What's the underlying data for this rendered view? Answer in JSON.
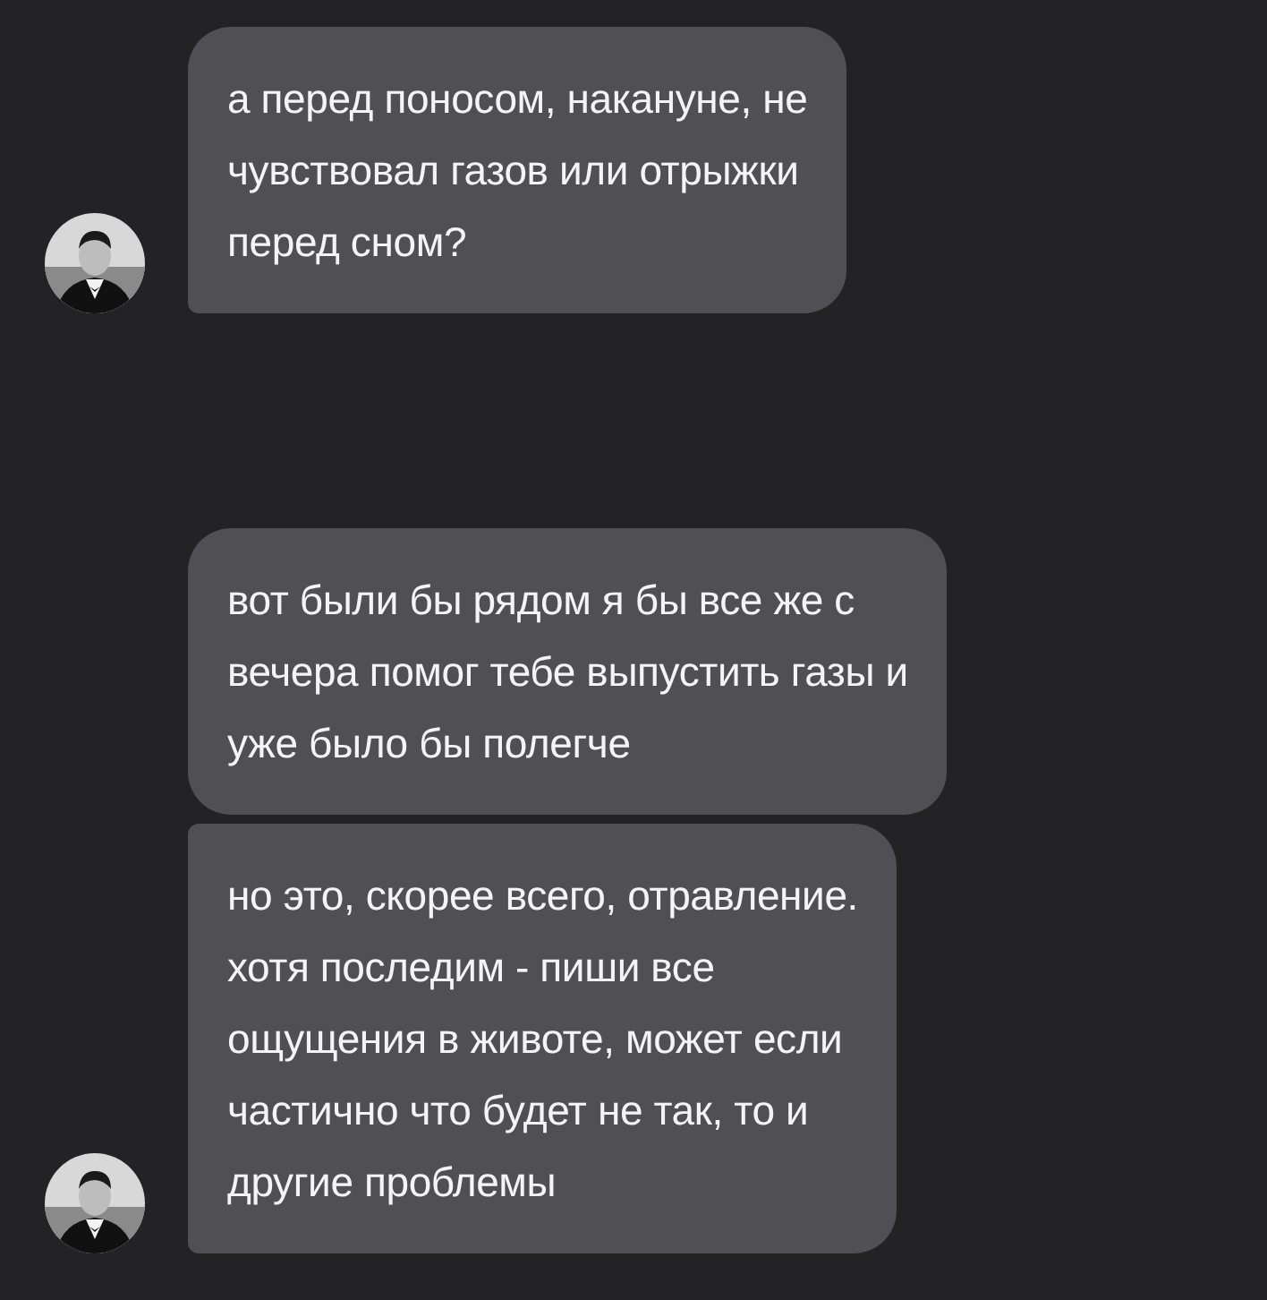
{
  "groups": [
    {
      "avatar": true,
      "messages": [
        {
          "lines": [
            "а перед поносом, накануне, не",
            "чувствовал газов или отрыжки",
            "перед сном?"
          ]
        }
      ]
    },
    {
      "avatar": true,
      "messages": [
        {
          "lines": [
            "вот были бы рядом я бы все же с",
            "вечера помог тебе выпустить газы и",
            "уже было бы полегче"
          ]
        },
        {
          "lines": [
            "но это, скорее всего, отравление.",
            "хотя последим - пиши все",
            "ощущения в животе, может если",
            "частично что будет не так, то и",
            "другие проблемы"
          ]
        }
      ]
    }
  ]
}
